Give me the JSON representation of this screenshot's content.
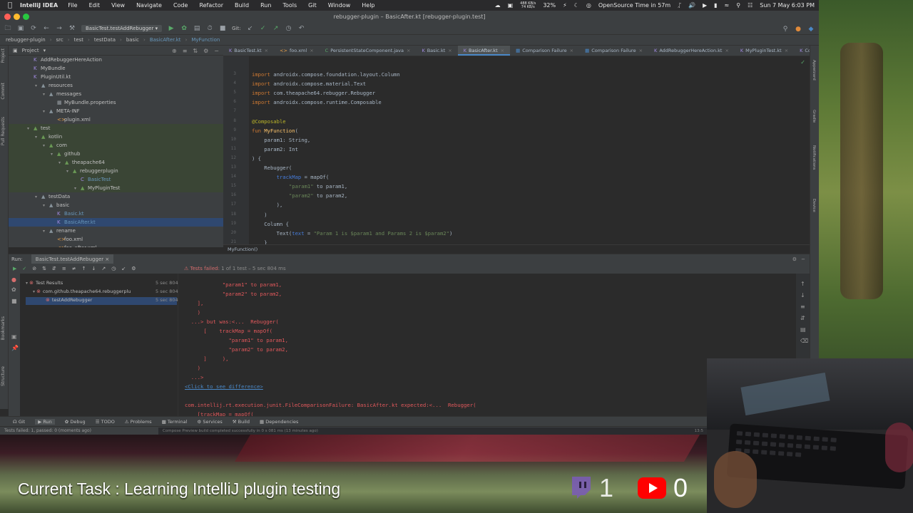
{
  "menubar": {
    "app": "IntelliJ IDEA",
    "items": [
      "File",
      "Edit",
      "View",
      "Navigate",
      "Code",
      "Refactor",
      "Build",
      "Run",
      "Tools",
      "Git",
      "Window",
      "Help"
    ],
    "status": {
      "net_up": "488 KB/s",
      "net_down": "74 KB/s",
      "cpu": "32%",
      "reminder": "OpenSource Time in 57m",
      "datetime": "Sun 7 May  6:03 PM"
    }
  },
  "window": {
    "title": "rebugger-plugin – BasicAfter.kt [rebugger-plugin.test]"
  },
  "toolbar": {
    "run_config": "BasicTest.testAddRebugger",
    "vcs_label": "Git:"
  },
  "breadcrumb": [
    "rebugger-plugin",
    "src",
    "test",
    "testData",
    "basic",
    "BasicAfter.kt",
    "MyFunction"
  ],
  "project_panel": {
    "title": "Project",
    "tree": [
      {
        "label": "AddRebuggerHereAction",
        "indent": 0,
        "kind": "kt"
      },
      {
        "label": "MyBundle",
        "indent": 0,
        "kind": "kt"
      },
      {
        "label": "PluginUtil.kt",
        "indent": 0,
        "kind": "kt"
      },
      {
        "label": "resources",
        "indent": 1,
        "kind": "folder"
      },
      {
        "label": "messages",
        "indent": 2,
        "kind": "folder"
      },
      {
        "label": "MyBundle.properties",
        "indent": 3,
        "kind": "prop"
      },
      {
        "label": "META-INF",
        "indent": 2,
        "kind": "folder"
      },
      {
        "label": "plugin.xml",
        "indent": 3,
        "kind": "xml"
      },
      {
        "label": "test",
        "indent": 0,
        "kind": "test"
      },
      {
        "label": "kotlin",
        "indent": 1,
        "kind": "test"
      },
      {
        "label": "com",
        "indent": 2,
        "kind": "test"
      },
      {
        "label": "github",
        "indent": 3,
        "kind": "test"
      },
      {
        "label": "theapache64",
        "indent": 4,
        "kind": "test"
      },
      {
        "label": "rebuggerplugin",
        "indent": 5,
        "kind": "test"
      },
      {
        "label": "BasicTest",
        "indent": 6,
        "kind": "testfile"
      },
      {
        "label": "MyPluginTest",
        "indent": 6,
        "kind": "test"
      },
      {
        "label": "testData",
        "indent": 1,
        "kind": "folder"
      },
      {
        "label": "basic",
        "indent": 2,
        "kind": "folder"
      },
      {
        "label": "Basic.kt",
        "indent": 3,
        "kind": "ktblue"
      },
      {
        "label": "BasicAfter.kt",
        "indent": 3,
        "kind": "ktsel"
      },
      {
        "label": "rename",
        "indent": 2,
        "kind": "folder"
      },
      {
        "label": "foo.xml",
        "indent": 3,
        "kind": "xml"
      },
      {
        "label": "foo_after.xml",
        "indent": 3,
        "kind": "xml"
      }
    ]
  },
  "tabs": [
    {
      "label": "BasicTest.kt",
      "active": false
    },
    {
      "label": "foo.xml",
      "active": false
    },
    {
      "label": "PersistentStateComponent.java",
      "active": false
    },
    {
      "label": "Basic.kt",
      "active": false
    },
    {
      "label": "BasicAfter.kt",
      "active": true
    },
    {
      "label": "Comparison Failure",
      "active": false
    },
    {
      "label": "Comparison Failure",
      "active": false
    },
    {
      "label": "AddRebuggerHereAction.kt",
      "active": false
    },
    {
      "label": "MyPluginTest.kt",
      "active": false
    },
    {
      "label": "Code",
      "active": false
    }
  ],
  "editor": {
    "line_numbers": [
      "3",
      "4",
      "5",
      "6",
      "7",
      "8",
      "9",
      "10",
      "11",
      "12",
      "13",
      "14",
      "15",
      "16",
      "17",
      "18",
      "19",
      "20",
      "21"
    ],
    "lines": [
      "import androidx.compose.foundation.layout.Column",
      "import androidx.compose.material.Text",
      "import com.theapache64.rebugger.Rebugger",
      "import androidx.compose.runtime.Composable",
      "",
      "@Composable",
      "fun MyFunction(",
      "    param1: String,",
      "    param2: Int",
      ") {",
      "    Rebugger(",
      "        trackMap = mapOf(",
      "            \"param1\" to param1,",
      "            \"param2\" to param2,",
      "        ),",
      "    )",
      "    Column {",
      "        Text(text = \"Param 1 is $param1 and Params 2 is $param2\")",
      "    }"
    ],
    "footer_crumb": "MyFunction()"
  },
  "run_panel": {
    "label": "Run:",
    "tab": "BasicTest.testAddRebugger",
    "status_prefix": "Tests failed:",
    "status_detail": "1 of 1 test – 5 sec 804 ms",
    "tree": [
      {
        "label": "Test Results",
        "time": "5 sec 804 ms"
      },
      {
        "label": "com.github.theapache64.rebuggerplu",
        "time": "5 sec 804 ms"
      },
      {
        "label": "testAddRebugger",
        "time": "5 sec 804 ms"
      }
    ],
    "console": [
      "            \"param1\" to param1,",
      "            \"param2\" to param2,",
      "    ],",
      "    )",
      "  ...> but was:<...  Rebugger(",
      "      [    trackMap = mapOf(",
      "              \"param1\" to param1,",
      "              \"param2\" to param2,",
      "      ]     ),",
      "    )",
      "  ...>",
      "<Click to see difference>",
      "",
      "com.intellij.rt.execution.junit.FileComparisonFailure: BasicAfter.kt expected:<...  Rebugger(",
      "    [trackMap = mapOf("
    ]
  },
  "bottom_tools": [
    "Git",
    "Run",
    "Debug",
    "TODO",
    "Problems",
    "Terminal",
    "Services",
    "Build",
    "Dependencies"
  ],
  "statusbar": {
    "text": "Tests failed: 1, passed: 0 (moments ago)",
    "notification": "Compose Preview build completed successfully in 0 s 081 ms (13 minutes ago)",
    "position": "13:5"
  },
  "overlay": {
    "task": "Current Task : Learning IntelliJ plugin testing",
    "twitch_count": "1",
    "youtube_count": "0"
  }
}
